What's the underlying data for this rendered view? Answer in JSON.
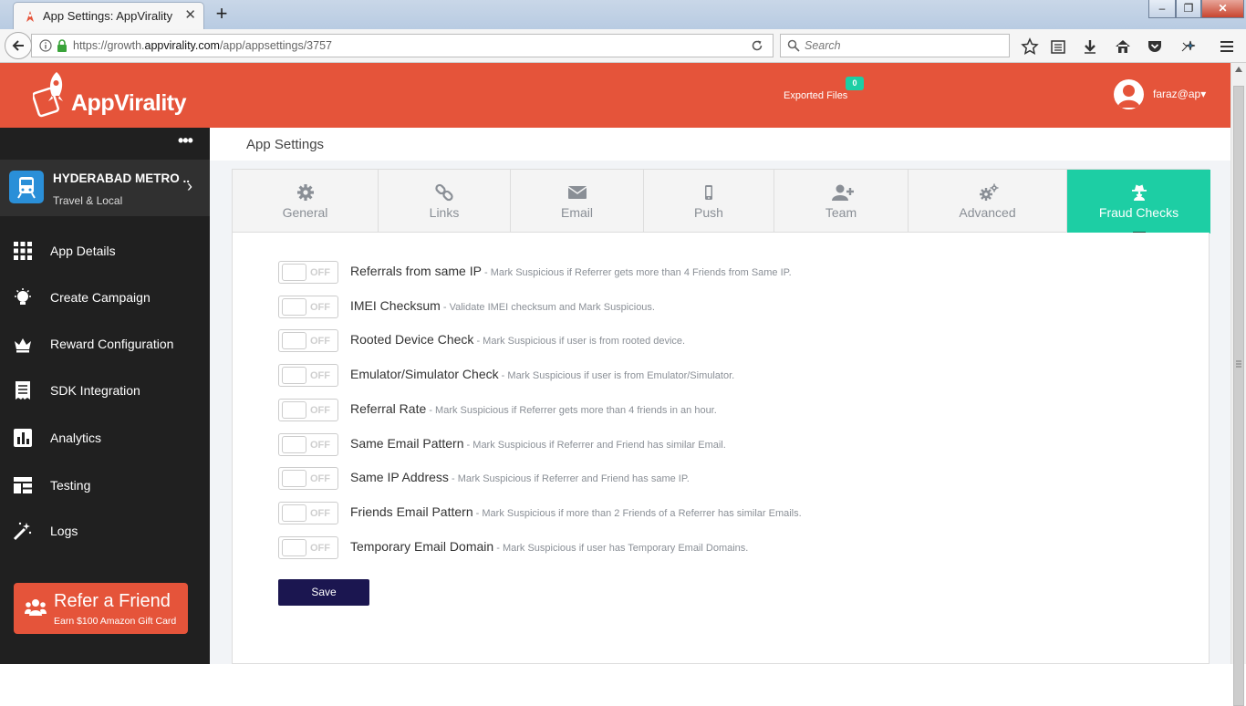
{
  "browser": {
    "tab_title": "App Settings: AppVirality",
    "tab_close": "✕",
    "new_tab": "+",
    "url_prefix": "https://growth.",
    "url_domain": "appvirality.com",
    "url_path": "/app/appsettings/3757",
    "search_placeholder": "Search",
    "window_min": "‒",
    "window_restore": "❐",
    "window_close": "✕"
  },
  "header": {
    "logo": "AppVirality",
    "exported_label": "Exported Files",
    "exported_count": "0",
    "username": "faraz@ap",
    "user_caret": "▾"
  },
  "sidebar": {
    "more": "•••",
    "app_name": "HYDERABAD METRO ..",
    "app_category": "Travel & Local",
    "chevron": "›",
    "items": [
      {
        "label": "App Details",
        "icon": "grid-icon"
      },
      {
        "label": "Create Campaign",
        "icon": "bulb-icon"
      },
      {
        "label": "Reward Configuration",
        "icon": "crown-icon"
      },
      {
        "label": "SDK Integration",
        "icon": "receipt-icon"
      },
      {
        "label": "Analytics",
        "icon": "bar-chart-icon"
      },
      {
        "label": "Testing",
        "icon": "layout-icon"
      },
      {
        "label": "Logs",
        "icon": "magic-wand-icon"
      }
    ],
    "refer_title": "Refer a Friend",
    "refer_sub": "Earn $100 Amazon Gift Card"
  },
  "page": {
    "title": "App Settings",
    "tabs": [
      {
        "label": "General",
        "icon": "gear-icon"
      },
      {
        "label": "Links",
        "icon": "link-icon"
      },
      {
        "label": "Email",
        "icon": "envelope-icon"
      },
      {
        "label": "Push",
        "icon": "mobile-icon"
      },
      {
        "label": "Team",
        "icon": "user-plus-icon"
      },
      {
        "label": "Advanced",
        "icon": "gears-icon"
      },
      {
        "label": "Fraud Checks",
        "icon": "spy-icon",
        "active": true
      }
    ],
    "checks": [
      {
        "title": "Referrals from same IP",
        "desc": " - Mark Suspicious if Referrer gets more than 4 Friends from Same IP.",
        "state": "OFF"
      },
      {
        "title": "IMEI Checksum",
        "desc": " - Validate IMEI checksum and Mark Suspicious.",
        "state": "OFF"
      },
      {
        "title": "Rooted Device Check",
        "desc": " - Mark Suspicious if user is from rooted device.",
        "state": "OFF"
      },
      {
        "title": "Emulator/Simulator Check",
        "desc": " - Mark Suspicious if user is from Emulator/Simulator.",
        "state": "OFF"
      },
      {
        "title": "Referral Rate",
        "desc": " - Mark Suspicious if Referrer gets more than 4 friends in an hour.",
        "state": "OFF"
      },
      {
        "title": "Same Email Pattern",
        "desc": " - Mark Suspicious if Referrer and Friend has similar Email.",
        "state": "OFF"
      },
      {
        "title": "Same IP Address",
        "desc": " - Mark Suspicious if Referrer and Friend has same IP.",
        "state": "OFF"
      },
      {
        "title": "Friends Email Pattern",
        "desc": " - Mark Suspicious if more than 2 Friends of a Referrer has similar Emails.",
        "state": "OFF"
      },
      {
        "title": "Temporary Email Domain",
        "desc": " - Mark Suspicious if user has Temporary Email Domains.",
        "state": "OFF"
      }
    ],
    "save_label": "Save"
  },
  "colors": {
    "brand": "#e5543a",
    "accent": "#1dcea4",
    "sidebar_bg": "#202020",
    "save_button": "#1b1650"
  }
}
